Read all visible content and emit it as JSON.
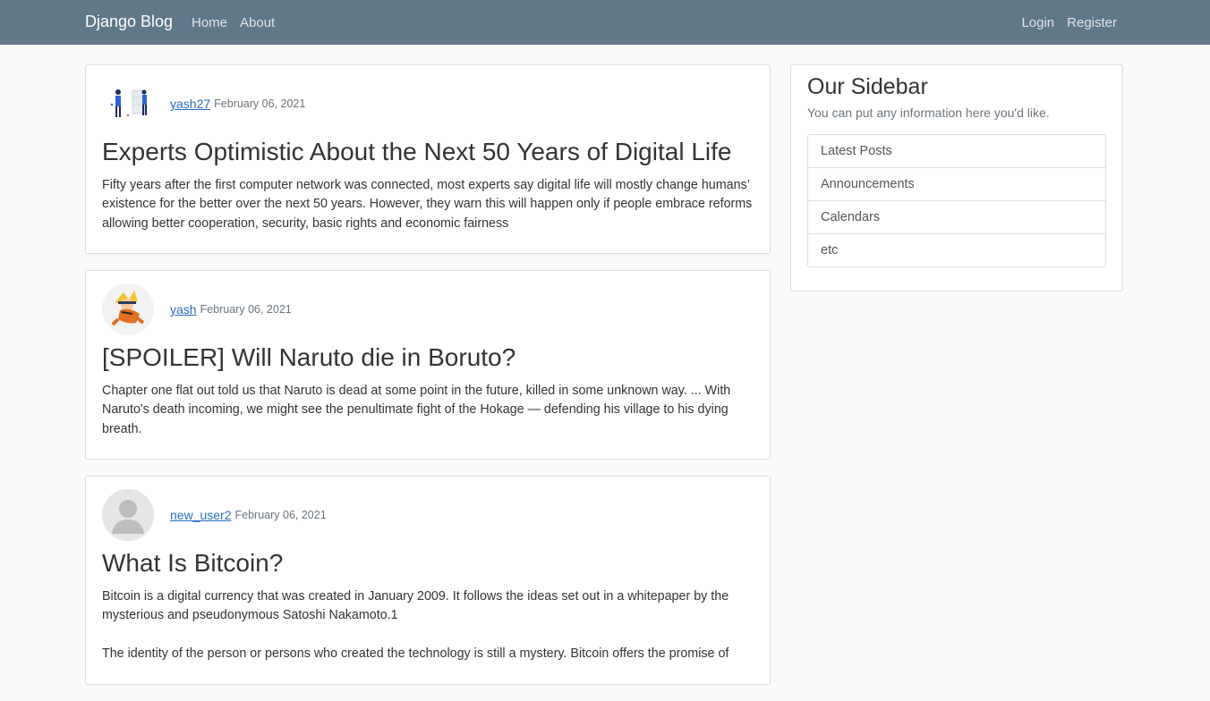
{
  "navbar": {
    "brand": "Django Blog",
    "left_links": [
      "Home",
      "About"
    ],
    "right_links": [
      "Login",
      "Register"
    ]
  },
  "posts": [
    {
      "author": "yash27",
      "date": "February 06, 2021",
      "title": "Experts Optimistic About the Next 50 Years of Digital Life",
      "content": "Fifty years after the first computer network was connected, most experts say digital life will mostly change humans’ existence for the better over the next 50 years. However, they warn this will happen only if people embrace reforms allowing better cooperation, security, basic rights and economic fairness"
    },
    {
      "author": "yash",
      "date": "February 06, 2021",
      "title": "[SPOILER] Will Naruto die in Boruto?",
      "content": "Chapter one flat out told us that Naruto is dead at some point in the future, killed in some unknown way. ... With Naruto's death incoming, we might see the penultimate fight of the Hokage — defending his village to his dying breath."
    },
    {
      "author": "new_user2",
      "date": "February 06, 2021",
      "title": "What Is Bitcoin?",
      "content": "Bitcoin is a digital currency that was created in January 2009. It follows the ideas set out in a whitepaper by the mysterious and pseudonymous Satoshi Nakamoto.1\n\n The identity of the person or persons who created the technology is still a mystery. Bitcoin offers the promise of"
    }
  ],
  "sidebar": {
    "title": "Our Sidebar",
    "description": "You can put any information here you'd like.",
    "items": [
      "Latest Posts",
      "Announcements",
      "Calendars",
      "etc"
    ]
  }
}
